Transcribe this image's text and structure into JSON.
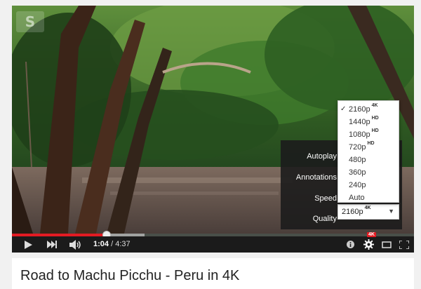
{
  "player": {
    "channel_logo_text": "S",
    "settings_menu": {
      "autoplay_label": "Autoplay",
      "annotations_label": "Annotations",
      "speed_label": "Speed",
      "quality_label": "Quality",
      "quality_value": "2160p",
      "quality_value_badge": "4K"
    },
    "quality_options": [
      {
        "label": "2160p",
        "badge": "4K",
        "selected": true
      },
      {
        "label": "1440p",
        "badge": "HD",
        "selected": false
      },
      {
        "label": "1080p",
        "badge": "HD",
        "selected": false
      },
      {
        "label": "720p",
        "badge": "HD",
        "selected": false
      },
      {
        "label": "480p",
        "badge": "",
        "selected": false
      },
      {
        "label": "360p",
        "badge": "",
        "selected": false
      },
      {
        "label": "240p",
        "badge": "",
        "selected": false
      },
      {
        "label": "Auto",
        "badge": "",
        "selected": false
      }
    ],
    "progress": {
      "played_fraction": 0.235
    },
    "current_time": "1:04",
    "separator": " / ",
    "duration": "4:37",
    "settings_badge": "4K",
    "icons": [
      "play-icon",
      "next-icon",
      "volume-icon",
      "info-icon",
      "gear-icon",
      "theater-mode-icon",
      "fullscreen-icon"
    ],
    "colors": {
      "accent": "#e31b23",
      "menu_bg": "#1c1c1c"
    }
  },
  "video": {
    "title": "Road to Machu Picchu - Peru in 4K"
  }
}
